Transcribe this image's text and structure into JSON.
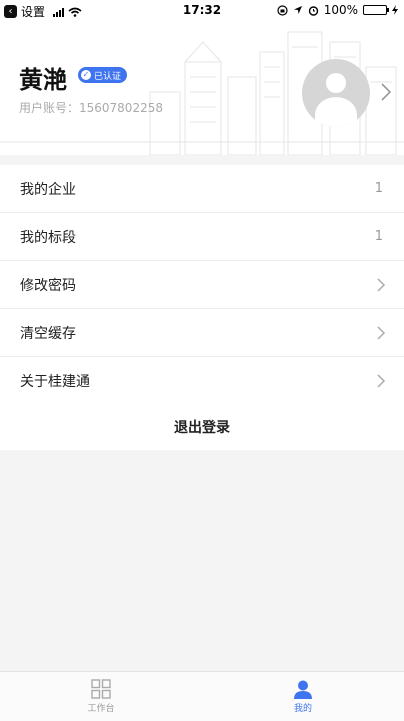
{
  "status_bar": {
    "back_label": "设置",
    "time": "17:32",
    "battery": "100%"
  },
  "profile": {
    "name": "黄滟",
    "badge": "已认证",
    "account": "用户账号：15607802258"
  },
  "menu": {
    "items": [
      {
        "label": "我的企业",
        "value": "1"
      },
      {
        "label": "我的标段",
        "value": "1"
      },
      {
        "label": "修改密码"
      },
      {
        "label": "清空缓存"
      },
      {
        "label": "关于桂建通"
      }
    ]
  },
  "logout_label": "退出登录",
  "tab_bar": {
    "tabs": [
      {
        "label": "工作台",
        "icon": "grid-icon",
        "active": false
      },
      {
        "label": "我的",
        "icon": "person-icon",
        "active": true
      }
    ]
  },
  "colors": {
    "accent": "#3f74f0",
    "background": "#f4f4f4"
  }
}
